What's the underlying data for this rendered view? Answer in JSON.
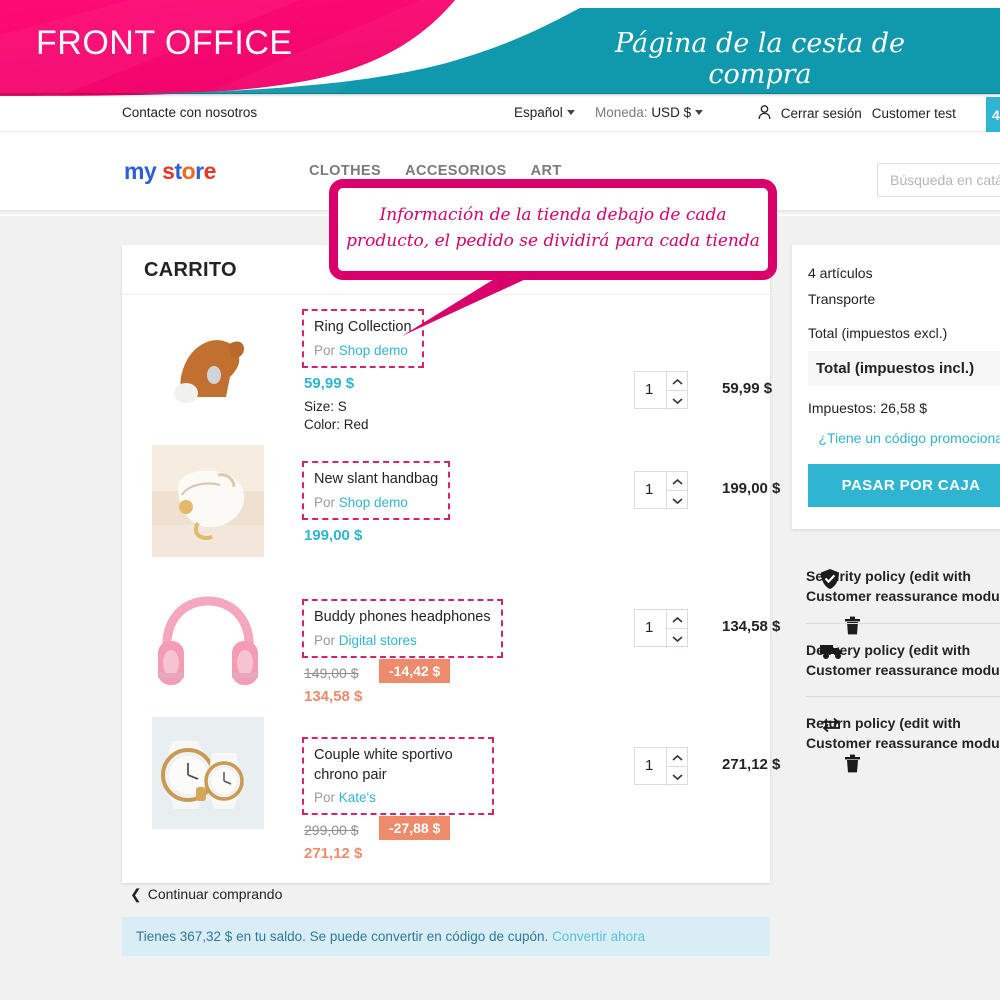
{
  "banner": {
    "title": "FRONT OFFICE",
    "subtitle": "Página de la cesta de compra",
    "pink": "#f2056d",
    "teal": "#1098ad"
  },
  "callout": {
    "text": "Información de la tienda debajo de cada producto, el pedido se dividirá para cada tienda",
    "color": "#d9006c"
  },
  "topbar": {
    "contact": "Contacte con nosotros",
    "language": "Español",
    "currency_label": "Moneda:",
    "currency_value": "USD $",
    "logout": "Cerrar sesión",
    "customer": "Customer test",
    "cart_count": "4"
  },
  "header": {
    "logo": "my store",
    "nav": [
      "CLOTHES",
      "ACCESORIOS",
      "ART"
    ],
    "search_placeholder": "Búsqueda en catálogo"
  },
  "cart": {
    "title": "CARRITO",
    "by_label": "Por",
    "items": [
      {
        "name": "Ring Collection",
        "shop": "Shop demo",
        "unit_price": "59,99 $",
        "attributes": [
          "Size: S",
          "Color: Red"
        ],
        "qty": "1",
        "line_total": "59,99 $",
        "old_price": "",
        "discount": "",
        "new_price": ""
      },
      {
        "name": "New slant handbag",
        "shop": "Shop demo",
        "unit_price": "199,00 $",
        "attributes": [],
        "qty": "1",
        "line_total": "199,00 $",
        "old_price": "",
        "discount": "",
        "new_price": ""
      },
      {
        "name": "Buddy phones headphones",
        "shop": "Digital stores",
        "unit_price": "",
        "attributes": [],
        "qty": "1",
        "line_total": "134,58 $",
        "old_price": "149,00 $",
        "discount": "-14,42 $",
        "new_price": "134,58 $"
      },
      {
        "name": "Couple white sportivo chrono pair",
        "shop": "Kate's",
        "unit_price": "",
        "attributes": [],
        "qty": "1",
        "line_total": "271,12 $",
        "old_price": "299,00 $",
        "discount": "-27,88 $",
        "new_price": "271,12 $"
      }
    ]
  },
  "summary": {
    "items_count": "4 artículos",
    "shipping": "Transporte",
    "total_excl": "Total (impuestos excl.)",
    "total_incl": "Total (impuestos incl.)",
    "taxes": "Impuestos: 26,58 $",
    "promo_link": "¿Tiene un código promocional?",
    "checkout": "PASAR POR CAJA",
    "accent": "#2fb5d2"
  },
  "reassurance": [
    {
      "icon": "shield-check-icon",
      "text": "Security policy (edit with Customer reassurance module)"
    },
    {
      "icon": "truck-icon",
      "text": "Delivery policy (edit with Customer reassurance module)"
    },
    {
      "icon": "exchange-icon",
      "text": "Return policy (edit with Customer reassurance module)"
    }
  ],
  "footer": {
    "continue_shopping": "Continuar comprando",
    "notice_text": "Tienes 367,32 $ en tu saldo. Se puede convertir en código de cupón.",
    "notice_link": "Convertir ahora"
  }
}
